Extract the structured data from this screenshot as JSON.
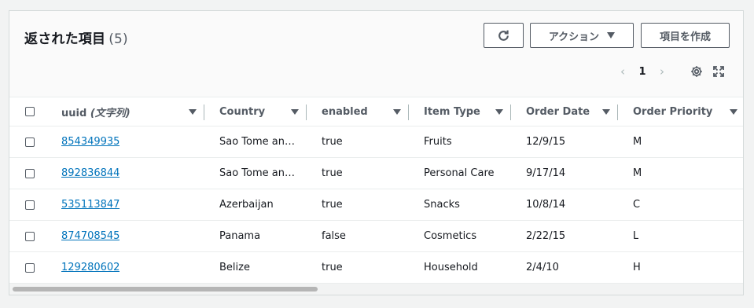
{
  "header": {
    "title": "返された項目",
    "count": "(5)",
    "actions_label": "アクション",
    "create_label": "項目を作成"
  },
  "pagination": {
    "current_page": "1",
    "prev": "‹",
    "next": "›"
  },
  "table": {
    "columns": [
      {
        "label": "uuid",
        "suffix": "(文字列)"
      },
      {
        "label": "Country"
      },
      {
        "label": "enabled"
      },
      {
        "label": "Item Type"
      },
      {
        "label": "Order Date"
      },
      {
        "label": "Order Priority"
      }
    ],
    "rows": [
      {
        "uuid": "854349935",
        "country": "Sao Tome and Principe",
        "enabled": "true",
        "item_type": "Fruits",
        "order_date": "12/9/15",
        "priority": "M"
      },
      {
        "uuid": "892836844",
        "country": "Sao Tome and Principe",
        "enabled": "true",
        "item_type": "Personal Care",
        "order_date": "9/17/14",
        "priority": "M"
      },
      {
        "uuid": "535113847",
        "country": "Azerbaijan",
        "enabled": "true",
        "item_type": "Snacks",
        "order_date": "10/8/14",
        "priority": "C"
      },
      {
        "uuid": "874708545",
        "country": "Panama",
        "enabled": "false",
        "item_type": "Cosmetics",
        "order_date": "2/22/15",
        "priority": "L"
      },
      {
        "uuid": "129280602",
        "country": "Belize",
        "enabled": "true",
        "item_type": "Household",
        "order_date": "2/4/10",
        "priority": "H"
      }
    ]
  },
  "colors": {
    "link": "#0073bb",
    "border": "#545b64",
    "text": "#16191f"
  }
}
